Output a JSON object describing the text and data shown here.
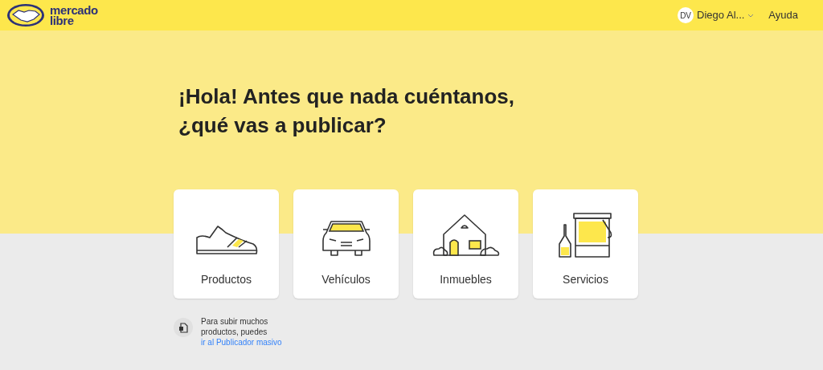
{
  "header": {
    "logo_text": [
      "mercado",
      "libre"
    ],
    "user": {
      "initials": "DV",
      "name": "Diego Al..."
    },
    "help": "Ayuda"
  },
  "heading": [
    "¡Hola! Antes que nada cuéntanos,",
    "¿qué vas a publicar?"
  ],
  "categories": [
    {
      "kind": "shoe",
      "label": "Productos"
    },
    {
      "kind": "car",
      "label": "Vehículos"
    },
    {
      "kind": "house",
      "label": "Inmuebles"
    },
    {
      "kind": "paint",
      "label": "Servicios"
    }
  ],
  "bulk_note": {
    "text": "Para subir muchos productos, puedes",
    "link": "ir al Publicador masivo"
  }
}
